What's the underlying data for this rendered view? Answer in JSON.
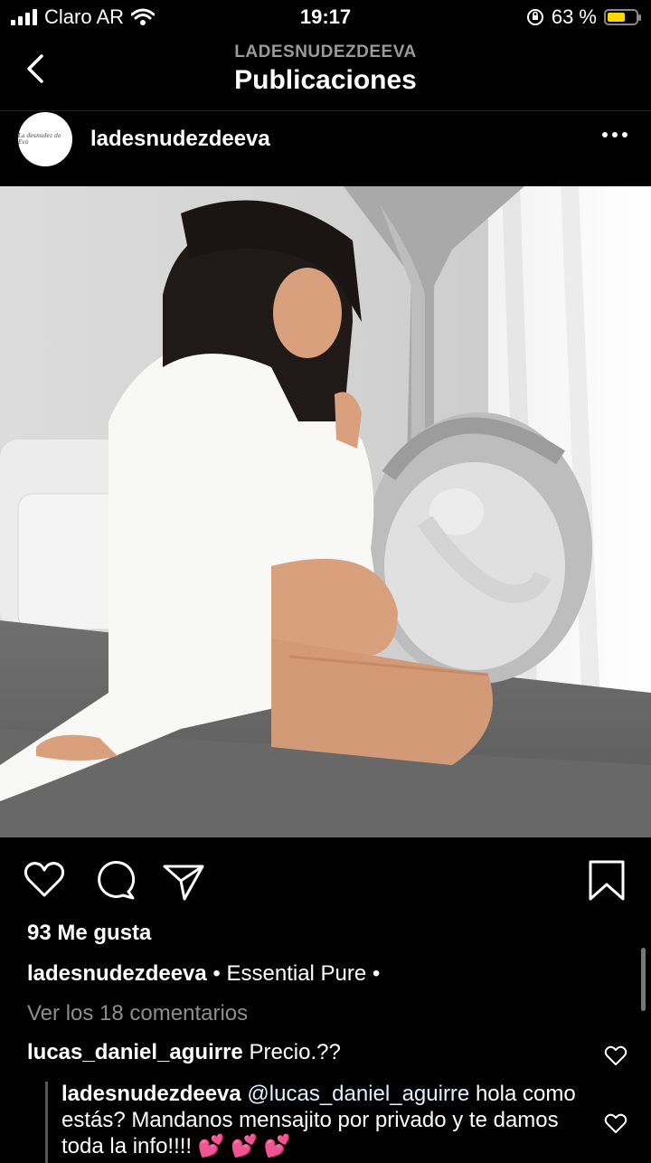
{
  "status_bar": {
    "carrier": "Claro AR",
    "time": "19:17",
    "battery_percent": "63 %",
    "battery_level": 0.63,
    "battery_color": "#ffd60a"
  },
  "nav": {
    "subtitle": "LADESNUDEZDEEVA",
    "title": "Publicaciones",
    "back_icon": "chevron-left-icon"
  },
  "post": {
    "avatar_text": "La desnudez de Eva",
    "username": "ladesnudezdeeva",
    "more_icon": "more-horizontal-icon",
    "actions": [
      "heart-icon",
      "comment-icon",
      "share-icon",
      "bookmark-icon"
    ],
    "likes": "93 Me gusta",
    "caption_user": "ladesnudezdeeva",
    "caption_text": " • Essential Pure •",
    "view_comments": "Ver los 18 comentarios",
    "comments": [
      {
        "user": "lucas_daniel_aguirre",
        "text": " Precio.??"
      }
    ],
    "reply": {
      "user": "ladesnudezdeeva",
      "mention": "@lucas_daniel_aguirre",
      "text": " hola como estás? Mandanos mensajito por privado y te damos toda la info!!!! 💕 💕 💕"
    }
  }
}
